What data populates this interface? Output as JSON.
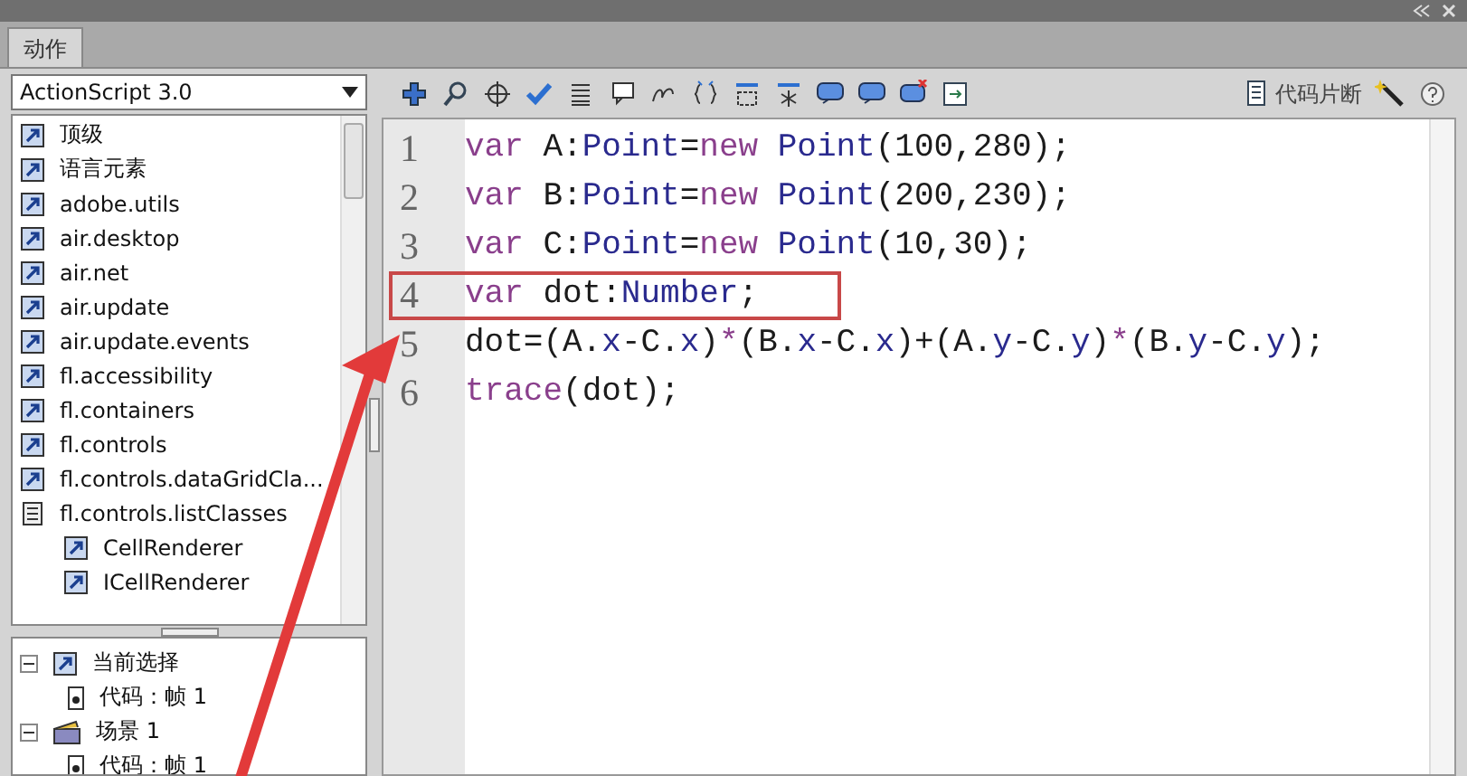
{
  "panel": {
    "tab": "动作"
  },
  "language_select": {
    "value": "ActionScript 3.0"
  },
  "library_tree": [
    {
      "label": "顶级",
      "kind": "package"
    },
    {
      "label": "语言元素",
      "kind": "package"
    },
    {
      "label": "adobe.utils",
      "kind": "package"
    },
    {
      "label": "air.desktop",
      "kind": "package"
    },
    {
      "label": "air.net",
      "kind": "package"
    },
    {
      "label": "air.update",
      "kind": "package"
    },
    {
      "label": "air.update.events",
      "kind": "package"
    },
    {
      "label": "fl.accessibility",
      "kind": "package"
    },
    {
      "label": "fl.containers",
      "kind": "package"
    },
    {
      "label": "fl.controls",
      "kind": "package"
    },
    {
      "label": "fl.controls.dataGridCla...",
      "kind": "package"
    },
    {
      "label": "fl.controls.listClasses",
      "kind": "folder",
      "children": [
        {
          "label": "CellRenderer",
          "kind": "package"
        },
        {
          "label": "ICellRenderer",
          "kind": "package"
        }
      ]
    }
  ],
  "script_tree": [
    {
      "label": "当前选择",
      "kind": "selection",
      "expanded": true,
      "children": [
        {
          "label": "代码：帧 1",
          "kind": "frame"
        }
      ]
    },
    {
      "label": "场景 1",
      "kind": "scene",
      "expanded": true,
      "children": [
        {
          "label": "代码：帧 1",
          "kind": "frame"
        }
      ]
    }
  ],
  "toolbar": {
    "snippets_button": "代码片断"
  },
  "code_lines": [
    {
      "number": "1",
      "highlighted": false,
      "tokens": [
        {
          "text": "var",
          "kind": "keyword"
        },
        {
          "text": " A:",
          "kind": "plain"
        },
        {
          "text": "Point",
          "kind": "type"
        },
        {
          "text": "=",
          "kind": "plain"
        },
        {
          "text": "new",
          "kind": "keyword"
        },
        {
          "text": " Point",
          "kind": "type"
        },
        {
          "text": "(100,280);",
          "kind": "plain"
        }
      ]
    },
    {
      "number": "2",
      "highlighted": false,
      "tokens": [
        {
          "text": "var",
          "kind": "keyword"
        },
        {
          "text": " B:",
          "kind": "plain"
        },
        {
          "text": "Point",
          "kind": "type"
        },
        {
          "text": "=",
          "kind": "plain"
        },
        {
          "text": "new",
          "kind": "keyword"
        },
        {
          "text": " Point",
          "kind": "type"
        },
        {
          "text": "(200,230);",
          "kind": "plain"
        }
      ]
    },
    {
      "number": "3",
      "highlighted": false,
      "tokens": [
        {
          "text": "var",
          "kind": "keyword"
        },
        {
          "text": " C:",
          "kind": "plain"
        },
        {
          "text": "Point",
          "kind": "type"
        },
        {
          "text": "=",
          "kind": "plain"
        },
        {
          "text": "new",
          "kind": "keyword"
        },
        {
          "text": " Point",
          "kind": "type"
        },
        {
          "text": "(10,30);",
          "kind": "plain"
        }
      ]
    },
    {
      "number": "4",
      "highlighted": true,
      "tokens": [
        {
          "text": "var",
          "kind": "keyword"
        },
        {
          "text": " dot:",
          "kind": "plain"
        },
        {
          "text": "Number",
          "kind": "type"
        },
        {
          "text": ";",
          "kind": "plain"
        }
      ]
    },
    {
      "number": "5",
      "highlighted": false,
      "tokens": [
        {
          "text": "dot=(A.",
          "kind": "plain"
        },
        {
          "text": "x",
          "kind": "type"
        },
        {
          "text": "-C.",
          "kind": "plain"
        },
        {
          "text": "x",
          "kind": "type"
        },
        {
          "text": ")",
          "kind": "plain"
        },
        {
          "text": "*",
          "kind": "keyword"
        },
        {
          "text": "(B.",
          "kind": "plain"
        },
        {
          "text": "x",
          "kind": "type"
        },
        {
          "text": "-C.",
          "kind": "plain"
        },
        {
          "text": "x",
          "kind": "type"
        },
        {
          "text": ")+(A.",
          "kind": "plain"
        },
        {
          "text": "y",
          "kind": "type"
        },
        {
          "text": "-C.",
          "kind": "plain"
        },
        {
          "text": "y",
          "kind": "type"
        },
        {
          "text": ")",
          "kind": "plain"
        },
        {
          "text": "*",
          "kind": "keyword"
        },
        {
          "text": "(B.",
          "kind": "plain"
        },
        {
          "text": "y",
          "kind": "type"
        },
        {
          "text": "-C.",
          "kind": "plain"
        },
        {
          "text": "y",
          "kind": "type"
        },
        {
          "text": ");",
          "kind": "plain"
        }
      ]
    },
    {
      "number": "6",
      "highlighted": false,
      "tokens": [
        {
          "text": "trace",
          "kind": "keyword"
        },
        {
          "text": "(dot);",
          "kind": "plain"
        }
      ]
    }
  ]
}
